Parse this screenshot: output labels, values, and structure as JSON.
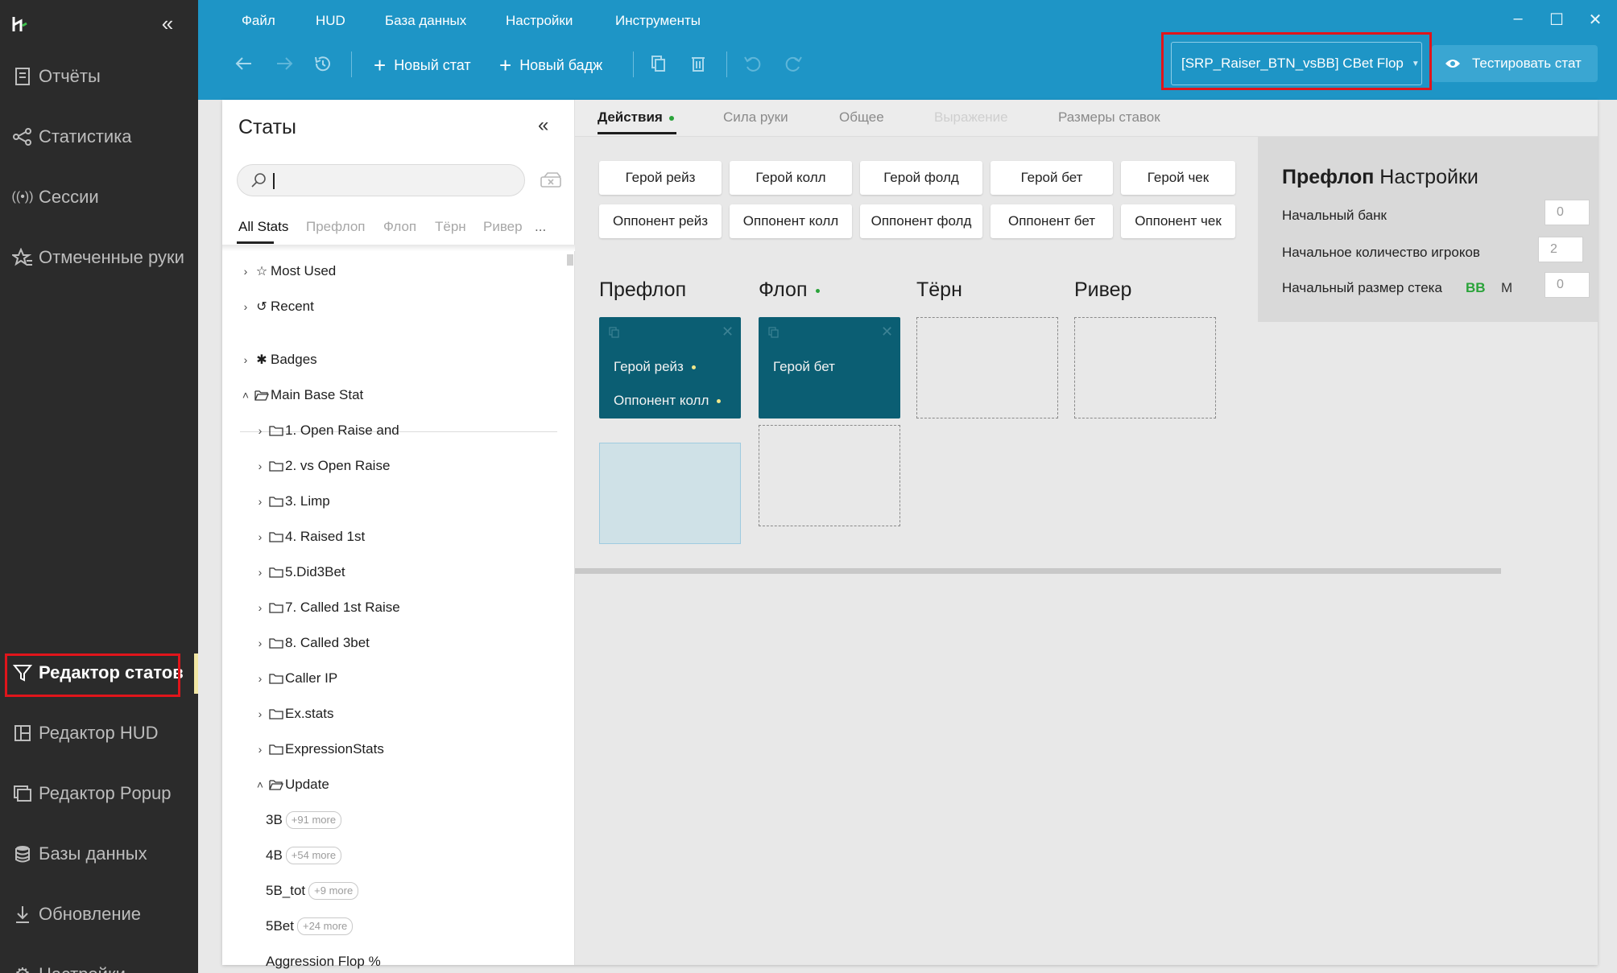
{
  "sidebar": {
    "items": [
      {
        "label": "Отчёты",
        "icon": "reports-icon"
      },
      {
        "label": "Статистика",
        "icon": "statistics-icon"
      },
      {
        "label": "Сессии",
        "icon": "sessions-icon"
      },
      {
        "label": "Отмеченные руки",
        "icon": "marked-hands-icon"
      },
      {
        "label": "Редактор статов",
        "icon": "filter-icon",
        "active": true
      },
      {
        "label": "Редактор HUD",
        "icon": "hud-icon"
      },
      {
        "label": "Редактор Popup",
        "icon": "popup-icon"
      },
      {
        "label": "Базы данных",
        "icon": "database-icon"
      },
      {
        "label": "Обновление",
        "icon": "download-icon"
      },
      {
        "label": "Настройки",
        "icon": "gear-icon"
      }
    ]
  },
  "menu": [
    "Файл",
    "HUD",
    "База данных",
    "Настройки",
    "Инструменты"
  ],
  "toolbar": {
    "new_stat": "Новый стат",
    "new_badge": "Новый бадж",
    "selected_stat": "[SRP_Raiser_BTN_vsBB] CBet Flop",
    "test_stat": "Тестировать стат"
  },
  "stats_panel": {
    "title": "Статы",
    "search": {
      "value": "",
      "placeholder": ""
    },
    "tabs": [
      "All Stats",
      "Префлоп",
      "Флоп",
      "Тёрн",
      "Ривер",
      "..."
    ],
    "tree": [
      {
        "label": "Most Used"
      },
      {
        "label": "Recent"
      },
      {
        "label": "Badges"
      },
      {
        "label": "Main Base Stat"
      },
      {
        "label": "1. Open Raise and"
      },
      {
        "label": "2. vs Open Raise"
      },
      {
        "label": "3. Limp"
      },
      {
        "label": "4. Raised 1st"
      },
      {
        "label": "5.Did3Bet"
      },
      {
        "label": "7. Called 1st Raise"
      },
      {
        "label": "8. Called 3bet"
      },
      {
        "label": "Caller IP"
      },
      {
        "label": "Ex.stats"
      },
      {
        "label": "ExpressionStats"
      },
      {
        "label": "Update"
      },
      {
        "label": "3B",
        "more": "+91 more"
      },
      {
        "label": "4B",
        "more": "+54 more"
      },
      {
        "label": "5B_tot",
        "more": "+9 more"
      },
      {
        "label": "5Bet",
        "more": "+24 more"
      },
      {
        "label": "Aggression Flop %"
      }
    ]
  },
  "editor": {
    "tabs": [
      "Действия",
      "Сила руки",
      "Общее",
      "Выражение",
      "Размеры ставок"
    ],
    "actions": [
      "Герой рейз",
      "Герой колл",
      "Герой фолд",
      "Герой бет",
      "Герой чек",
      "Оппонент рейз",
      "Оппонент колл",
      "Оппонент фолд",
      "Оппонент бет",
      "Оппонент чек"
    ],
    "streets": [
      "Префлоп",
      "Флоп",
      "Тёрн",
      "Ривер"
    ],
    "preflop_slot": [
      "Герой рейз",
      "Оппонент колл"
    ],
    "flop_slot": [
      "Герой бет"
    ]
  },
  "settings": {
    "title_bold": "Префлоп",
    "title_rest": " Настройки",
    "start_bank_label": "Начальный банк",
    "start_bank_value": "0",
    "start_players_label": "Начальное количество игроков",
    "start_players_value": "2",
    "start_stack_label": "Начальный размер стека",
    "unit_bb": "BB",
    "unit_m": "M",
    "start_stack_value": "0"
  },
  "colors": {
    "accent": "#1e95c6",
    "sidebar": "#2b2b2b",
    "slot": "#0b5e73",
    "highlight": "#e0151b",
    "green": "#2aa33a"
  }
}
